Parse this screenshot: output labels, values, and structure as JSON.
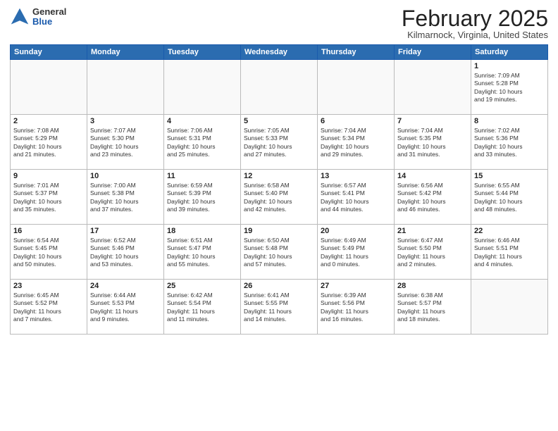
{
  "header": {
    "logo": {
      "general": "General",
      "blue": "Blue"
    },
    "title": "February 2025",
    "location": "Kilmarnock, Virginia, United States"
  },
  "days_of_week": [
    "Sunday",
    "Monday",
    "Tuesday",
    "Wednesday",
    "Thursday",
    "Friday",
    "Saturday"
  ],
  "weeks": [
    [
      {
        "day": "",
        "info": ""
      },
      {
        "day": "",
        "info": ""
      },
      {
        "day": "",
        "info": ""
      },
      {
        "day": "",
        "info": ""
      },
      {
        "day": "",
        "info": ""
      },
      {
        "day": "",
        "info": ""
      },
      {
        "day": "1",
        "info": "Sunrise: 7:09 AM\nSunset: 5:28 PM\nDaylight: 10 hours\nand 19 minutes."
      }
    ],
    [
      {
        "day": "2",
        "info": "Sunrise: 7:08 AM\nSunset: 5:29 PM\nDaylight: 10 hours\nand 21 minutes."
      },
      {
        "day": "3",
        "info": "Sunrise: 7:07 AM\nSunset: 5:30 PM\nDaylight: 10 hours\nand 23 minutes."
      },
      {
        "day": "4",
        "info": "Sunrise: 7:06 AM\nSunset: 5:31 PM\nDaylight: 10 hours\nand 25 minutes."
      },
      {
        "day": "5",
        "info": "Sunrise: 7:05 AM\nSunset: 5:33 PM\nDaylight: 10 hours\nand 27 minutes."
      },
      {
        "day": "6",
        "info": "Sunrise: 7:04 AM\nSunset: 5:34 PM\nDaylight: 10 hours\nand 29 minutes."
      },
      {
        "day": "7",
        "info": "Sunrise: 7:04 AM\nSunset: 5:35 PM\nDaylight: 10 hours\nand 31 minutes."
      },
      {
        "day": "8",
        "info": "Sunrise: 7:02 AM\nSunset: 5:36 PM\nDaylight: 10 hours\nand 33 minutes."
      }
    ],
    [
      {
        "day": "9",
        "info": "Sunrise: 7:01 AM\nSunset: 5:37 PM\nDaylight: 10 hours\nand 35 minutes."
      },
      {
        "day": "10",
        "info": "Sunrise: 7:00 AM\nSunset: 5:38 PM\nDaylight: 10 hours\nand 37 minutes."
      },
      {
        "day": "11",
        "info": "Sunrise: 6:59 AM\nSunset: 5:39 PM\nDaylight: 10 hours\nand 39 minutes."
      },
      {
        "day": "12",
        "info": "Sunrise: 6:58 AM\nSunset: 5:40 PM\nDaylight: 10 hours\nand 42 minutes."
      },
      {
        "day": "13",
        "info": "Sunrise: 6:57 AM\nSunset: 5:41 PM\nDaylight: 10 hours\nand 44 minutes."
      },
      {
        "day": "14",
        "info": "Sunrise: 6:56 AM\nSunset: 5:42 PM\nDaylight: 10 hours\nand 46 minutes."
      },
      {
        "day": "15",
        "info": "Sunrise: 6:55 AM\nSunset: 5:44 PM\nDaylight: 10 hours\nand 48 minutes."
      }
    ],
    [
      {
        "day": "16",
        "info": "Sunrise: 6:54 AM\nSunset: 5:45 PM\nDaylight: 10 hours\nand 50 minutes."
      },
      {
        "day": "17",
        "info": "Sunrise: 6:52 AM\nSunset: 5:46 PM\nDaylight: 10 hours\nand 53 minutes."
      },
      {
        "day": "18",
        "info": "Sunrise: 6:51 AM\nSunset: 5:47 PM\nDaylight: 10 hours\nand 55 minutes."
      },
      {
        "day": "19",
        "info": "Sunrise: 6:50 AM\nSunset: 5:48 PM\nDaylight: 10 hours\nand 57 minutes."
      },
      {
        "day": "20",
        "info": "Sunrise: 6:49 AM\nSunset: 5:49 PM\nDaylight: 11 hours\nand 0 minutes."
      },
      {
        "day": "21",
        "info": "Sunrise: 6:47 AM\nSunset: 5:50 PM\nDaylight: 11 hours\nand 2 minutes."
      },
      {
        "day": "22",
        "info": "Sunrise: 6:46 AM\nSunset: 5:51 PM\nDaylight: 11 hours\nand 4 minutes."
      }
    ],
    [
      {
        "day": "23",
        "info": "Sunrise: 6:45 AM\nSunset: 5:52 PM\nDaylight: 11 hours\nand 7 minutes."
      },
      {
        "day": "24",
        "info": "Sunrise: 6:44 AM\nSunset: 5:53 PM\nDaylight: 11 hours\nand 9 minutes."
      },
      {
        "day": "25",
        "info": "Sunrise: 6:42 AM\nSunset: 5:54 PM\nDaylight: 11 hours\nand 11 minutes."
      },
      {
        "day": "26",
        "info": "Sunrise: 6:41 AM\nSunset: 5:55 PM\nDaylight: 11 hours\nand 14 minutes."
      },
      {
        "day": "27",
        "info": "Sunrise: 6:39 AM\nSunset: 5:56 PM\nDaylight: 11 hours\nand 16 minutes."
      },
      {
        "day": "28",
        "info": "Sunrise: 6:38 AM\nSunset: 5:57 PM\nDaylight: 11 hours\nand 18 minutes."
      },
      {
        "day": "",
        "info": ""
      }
    ]
  ]
}
